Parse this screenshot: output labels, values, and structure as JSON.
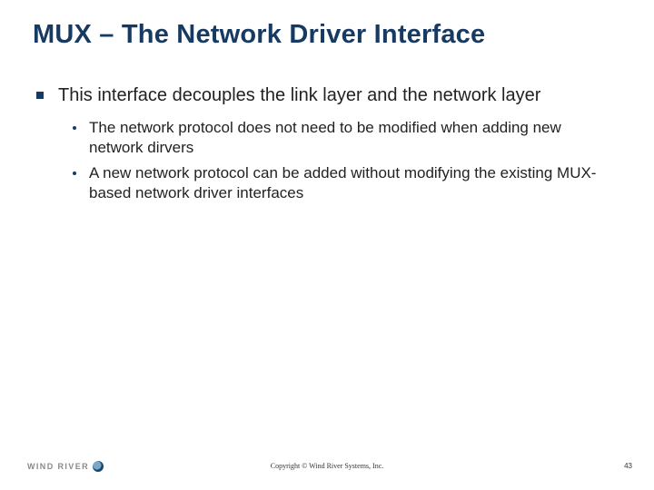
{
  "colors": {
    "heading": "#173a62",
    "body": "#222222"
  },
  "title": "MUX – The Network Driver Interface",
  "bullets": [
    {
      "text": "This interface decouples the link layer and the network layer",
      "children": [
        "The network protocol does not need to be modified when adding new network dirvers",
        "A new network protocol can be added without modifying the existing MUX-based network driver interfaces"
      ]
    }
  ],
  "footer": {
    "brand_word": "WIND RIVER",
    "copyright": "Copyright  ©  Wind River Systems, Inc.",
    "page_number": "43"
  }
}
